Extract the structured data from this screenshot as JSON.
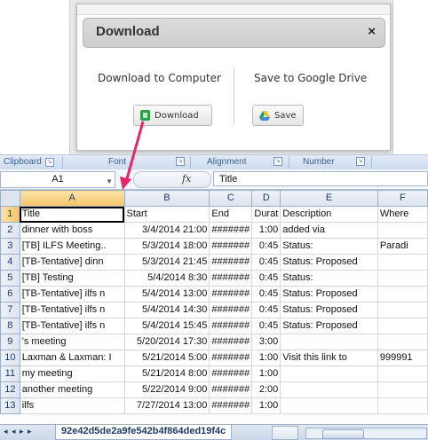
{
  "dialog": {
    "title": "Download",
    "close_label": "×",
    "left_option": {
      "text": "Download to Computer",
      "button_label": "Download"
    },
    "right_option": {
      "text": "Save to Google Drive",
      "button_label": "Save"
    }
  },
  "ribbon": {
    "groups": [
      "Clipboard",
      "Font",
      "Alignment",
      "Number"
    ]
  },
  "formula_bar": {
    "name_box": "A1",
    "fx_label": "fx",
    "content": "Title"
  },
  "grid": {
    "columns": [
      "A",
      "B",
      "C",
      "D",
      "E",
      "F"
    ],
    "rows": [
      {
        "n": "1",
        "A": "Title",
        "B": "Start",
        "C": "End",
        "D": "Durat",
        "E": "Description",
        "F": "Where"
      },
      {
        "n": "2",
        "A": "dinner with boss",
        "B": "3/4/2014 21:00",
        "C": "#######",
        "D": "1:00",
        "E": "added via",
        "F": ""
      },
      {
        "n": "3",
        "A": "[TB] ILFS Meeting..",
        "B": "5/3/2014 18:00",
        "C": "#######",
        "D": "0:45",
        "E": "Status:",
        "F": "Paradi"
      },
      {
        "n": "4",
        "A": "[TB-Tentative] dinn",
        "B": "5/3/2014 21:45",
        "C": "#######",
        "D": "0:45",
        "E": "Status: Proposed",
        "F": ""
      },
      {
        "n": "5",
        "A": "[TB] Testing",
        "B": "5/4/2014 8:30",
        "C": "#######",
        "D": "0:45",
        "E": "Status:",
        "F": ""
      },
      {
        "n": "6",
        "A": "[TB-Tentative] ilfs n",
        "B": "5/4/2014 13:00",
        "C": "#######",
        "D": "0:45",
        "E": "Status: Proposed",
        "F": ""
      },
      {
        "n": "7",
        "A": "[TB-Tentative] ilfs n",
        "B": "5/4/2014 14:30",
        "C": "#######",
        "D": "0:45",
        "E": "Status: Proposed",
        "F": ""
      },
      {
        "n": "8",
        "A": "[TB-Tentative] ilfs n",
        "B": "5/4/2014 15:45",
        "C": "#######",
        "D": "0:45",
        "E": "Status: Proposed",
        "F": ""
      },
      {
        "n": "9",
        "A": "'s meeting",
        "B": "5/20/2014 17:30",
        "C": "#######",
        "D": "3:00",
        "E": "",
        "F": ""
      },
      {
        "n": "10",
        "A": "Laxman & Laxman: I",
        "B": "5/21/2014 5:00",
        "C": "#######",
        "D": "1:00",
        "E": "Visit this link to",
        "F": "999991"
      },
      {
        "n": "11",
        "A": "my meeting",
        "B": "5/21/2014 8:00",
        "C": "#######",
        "D": "1:00",
        "E": "",
        "F": ""
      },
      {
        "n": "12",
        "A": "another meeting",
        "B": "5/22/2014 9:00",
        "C": "#######",
        "D": "2:00",
        "E": "",
        "F": ""
      },
      {
        "n": "13",
        "A": "ilfs",
        "B": "7/27/2014 13:00",
        "C": "#######",
        "D": "1:00",
        "E": "",
        "F": ""
      }
    ]
  },
  "sheet_tab": {
    "nav_arrows": "◂ ◂ ▸ ▸",
    "name": "92e42d5de2a9fe542b4f864ded19f4c"
  },
  "colors": {
    "arrow": "#e6266a",
    "header_bg": "#dce4ef",
    "selected_header": "#f4c46a"
  }
}
